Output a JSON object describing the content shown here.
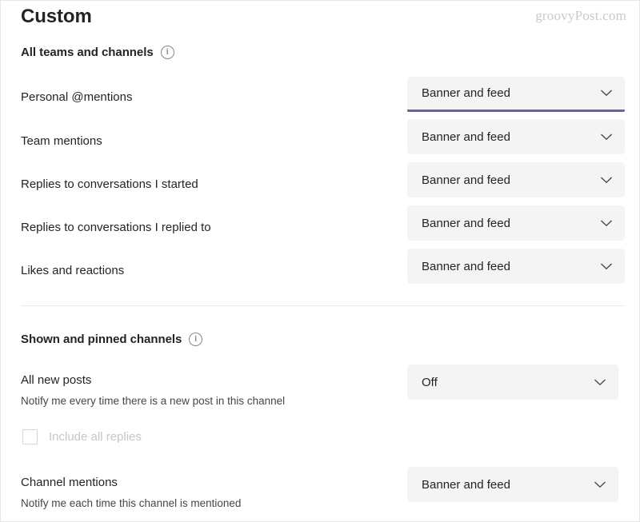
{
  "page": {
    "title": "Custom",
    "watermark": "groovyPost.com",
    "accent_color": "#6264A7",
    "dropdown_bg": "#f4f4f4"
  },
  "sections": [
    {
      "header": "All teams and channels",
      "info_icon": "info-circle-icon",
      "rows": [
        {
          "label": "Personal @mentions",
          "value": "Banner and feed",
          "focused": true
        },
        {
          "label": "Team mentions",
          "value": "Banner and feed",
          "focused": false
        },
        {
          "label": "Replies to conversations I started",
          "value": "Banner and feed",
          "focused": false
        },
        {
          "label": "Replies to conversations I replied to",
          "value": "Banner and feed",
          "focused": false
        },
        {
          "label": "Likes and reactions",
          "value": "Banner and feed",
          "focused": false
        }
      ]
    },
    {
      "header": "Shown and pinned channels",
      "info_icon": "info-circle-icon",
      "rows": [
        {
          "label": "All new posts",
          "sublabel": "Notify me every time there is a new post in this channel",
          "value": "Off",
          "focused": false
        },
        {
          "label": "Channel mentions",
          "sublabel": "Notify me each time this channel is mentioned",
          "value": "Banner and feed",
          "focused": false
        }
      ],
      "checkbox": {
        "label": "Include all replies",
        "checked": false,
        "disabled": true
      }
    }
  ]
}
